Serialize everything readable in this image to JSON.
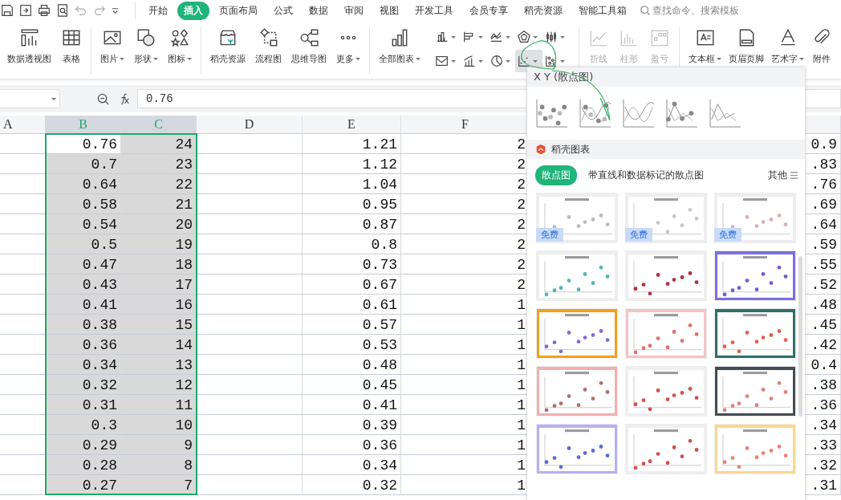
{
  "tabs": [
    {
      "label": "开始",
      "selected": false
    },
    {
      "label": "插入",
      "selected": true
    },
    {
      "label": "页面布局",
      "selected": false
    },
    {
      "label": "公式",
      "selected": false
    },
    {
      "label": "数据",
      "selected": false
    },
    {
      "label": "审阅",
      "selected": false
    },
    {
      "label": "视图",
      "selected": false
    },
    {
      "label": "开发工具",
      "selected": false
    },
    {
      "label": "会员专享",
      "selected": false
    },
    {
      "label": "稻壳资源",
      "selected": false
    },
    {
      "label": "智能工具箱",
      "selected": false
    }
  ],
  "search": {
    "placeholder": "查找命令、搜索模板"
  },
  "ribbon": [
    {
      "kind": "buttons",
      "items": [
        {
          "label": "数据透视图",
          "dropdown": false,
          "disabled": false
        },
        {
          "label": "表格",
          "dropdown": false,
          "disabled": false
        }
      ]
    },
    {
      "kind": "buttons",
      "items": [
        {
          "label": "图片",
          "dropdown": true,
          "disabled": false
        },
        {
          "label": "形状",
          "dropdown": true,
          "disabled": false
        },
        {
          "label": "图标",
          "dropdown": true,
          "disabled": false
        }
      ]
    },
    {
      "kind": "buttons",
      "items": [
        {
          "label": "稻壳资源",
          "dropdown": false,
          "disabled": false
        },
        {
          "label": "流程图",
          "dropdown": false,
          "disabled": false
        },
        {
          "label": "思维导图",
          "dropdown": false,
          "disabled": false
        },
        {
          "label": "更多",
          "dropdown": true,
          "disabled": false
        }
      ]
    },
    {
      "kind": "charts",
      "items": [
        {
          "label": "全部图表",
          "dropdown": true,
          "disabled": false
        }
      ],
      "chart_buttons": [
        {
          "selected": false
        },
        {
          "selected": false
        },
        {
          "selected": false
        },
        {
          "selected": false
        },
        {
          "selected": false
        },
        {
          "selected": false
        },
        {
          "selected": false
        },
        {
          "selected": false
        },
        {
          "selected": true
        },
        {
          "selected": false
        }
      ]
    },
    {
      "kind": "buttons",
      "items": [
        {
          "label": "折线",
          "dropdown": false,
          "disabled": true
        },
        {
          "label": "柱形",
          "dropdown": false,
          "disabled": true
        },
        {
          "label": "盈亏",
          "dropdown": false,
          "disabled": true
        }
      ]
    },
    {
      "kind": "buttons",
      "items": [
        {
          "label": "文本框",
          "dropdown": true,
          "disabled": false
        },
        {
          "label": "页眉页脚",
          "dropdown": false,
          "disabled": false
        },
        {
          "label": "艺术字",
          "dropdown": true,
          "disabled": false
        },
        {
          "label": "附件",
          "dropdown": false,
          "disabled": false
        }
      ]
    }
  ],
  "formula_bar": {
    "value": "0.76"
  },
  "columns": [
    {
      "label": "A",
      "selected": false
    },
    {
      "label": "B",
      "selected": true
    },
    {
      "label": "C",
      "selected": true
    },
    {
      "label": "D",
      "selected": false
    },
    {
      "label": "E",
      "selected": false
    },
    {
      "label": "F",
      "selected": false
    },
    {
      "selected": false
    }
  ],
  "rows": [
    {
      "active": true,
      "cells": [
        null,
        "0.76",
        "24",
        null,
        "1.21",
        "2",
        "0.9"
      ]
    },
    {
      "active": false,
      "cells": [
        null,
        "0.7",
        "23",
        null,
        "1.12",
        "2",
        ".83"
      ]
    },
    {
      "active": false,
      "cells": [
        null,
        "0.64",
        "22",
        null,
        "1.04",
        "2",
        ".76"
      ]
    },
    {
      "active": false,
      "cells": [
        null,
        "0.58",
        "21",
        null,
        "0.95",
        "2",
        ".69"
      ]
    },
    {
      "active": false,
      "cells": [
        null,
        "0.54",
        "20",
        null,
        "0.87",
        "2",
        ".64"
      ]
    },
    {
      "active": false,
      "cells": [
        null,
        "0.5",
        "19",
        null,
        "0.8",
        "2",
        ".59"
      ]
    },
    {
      "active": false,
      "cells": [
        null,
        "0.47",
        "18",
        null,
        "0.73",
        "2",
        ".55"
      ]
    },
    {
      "active": false,
      "cells": [
        null,
        "0.43",
        "17",
        null,
        "0.67",
        "2",
        ".52"
      ]
    },
    {
      "active": false,
      "cells": [
        null,
        "0.41",
        "16",
        null,
        "0.61",
        "1",
        ".48"
      ]
    },
    {
      "active": false,
      "cells": [
        null,
        "0.38",
        "15",
        null,
        "0.57",
        "1",
        ".45"
      ]
    },
    {
      "active": false,
      "cells": [
        null,
        "0.36",
        "14",
        null,
        "0.53",
        "1",
        ".42"
      ]
    },
    {
      "active": false,
      "cells": [
        null,
        "0.34",
        "13",
        null,
        "0.48",
        "1",
        "0.4"
      ]
    },
    {
      "active": false,
      "cells": [
        null,
        "0.32",
        "12",
        null,
        "0.45",
        "1",
        ".38"
      ]
    },
    {
      "active": false,
      "cells": [
        null,
        "0.31",
        "11",
        null,
        "0.41",
        "1",
        ".36"
      ]
    },
    {
      "active": false,
      "cells": [
        null,
        "0.3",
        "10",
        null,
        "0.39",
        "1",
        ".34"
      ]
    },
    {
      "active": false,
      "cells": [
        null,
        "0.29",
        "9",
        null,
        "0.36",
        "1",
        ".33"
      ]
    },
    {
      "active": false,
      "cells": [
        null,
        "0.28",
        "8",
        null,
        "0.34",
        "1",
        ".32"
      ]
    },
    {
      "active": false,
      "cells": [
        null,
        "0.27",
        "7",
        null,
        "0.32",
        "1",
        ".31"
      ]
    }
  ],
  "chart_menu": {
    "title": "X Y (散点图)",
    "section": "稻壳图表",
    "filters": [
      {
        "label": "散点图",
        "selected": true
      },
      {
        "label": "带直线和数据标记的散点图",
        "selected": false
      }
    ],
    "more": "其他",
    "templates": [
      {
        "kind": "picture",
        "badge": "免费"
      },
      {
        "kind": "picture",
        "badge": "免费"
      },
      {
        "kind": "picture",
        "badge": "免费"
      },
      {
        "kind": "picture"
      },
      {
        "kind": "picture"
      },
      {
        "kind": "picture"
      },
      {
        "kind": "picture"
      },
      {
        "kind": "picture"
      },
      {
        "kind": "picture"
      },
      {
        "kind": "picture"
      },
      {
        "kind": "picture"
      },
      {
        "kind": "picture"
      },
      {
        "kind": "picture"
      },
      {
        "kind": "picture"
      },
      {
        "kind": "picture"
      }
    ]
  }
}
